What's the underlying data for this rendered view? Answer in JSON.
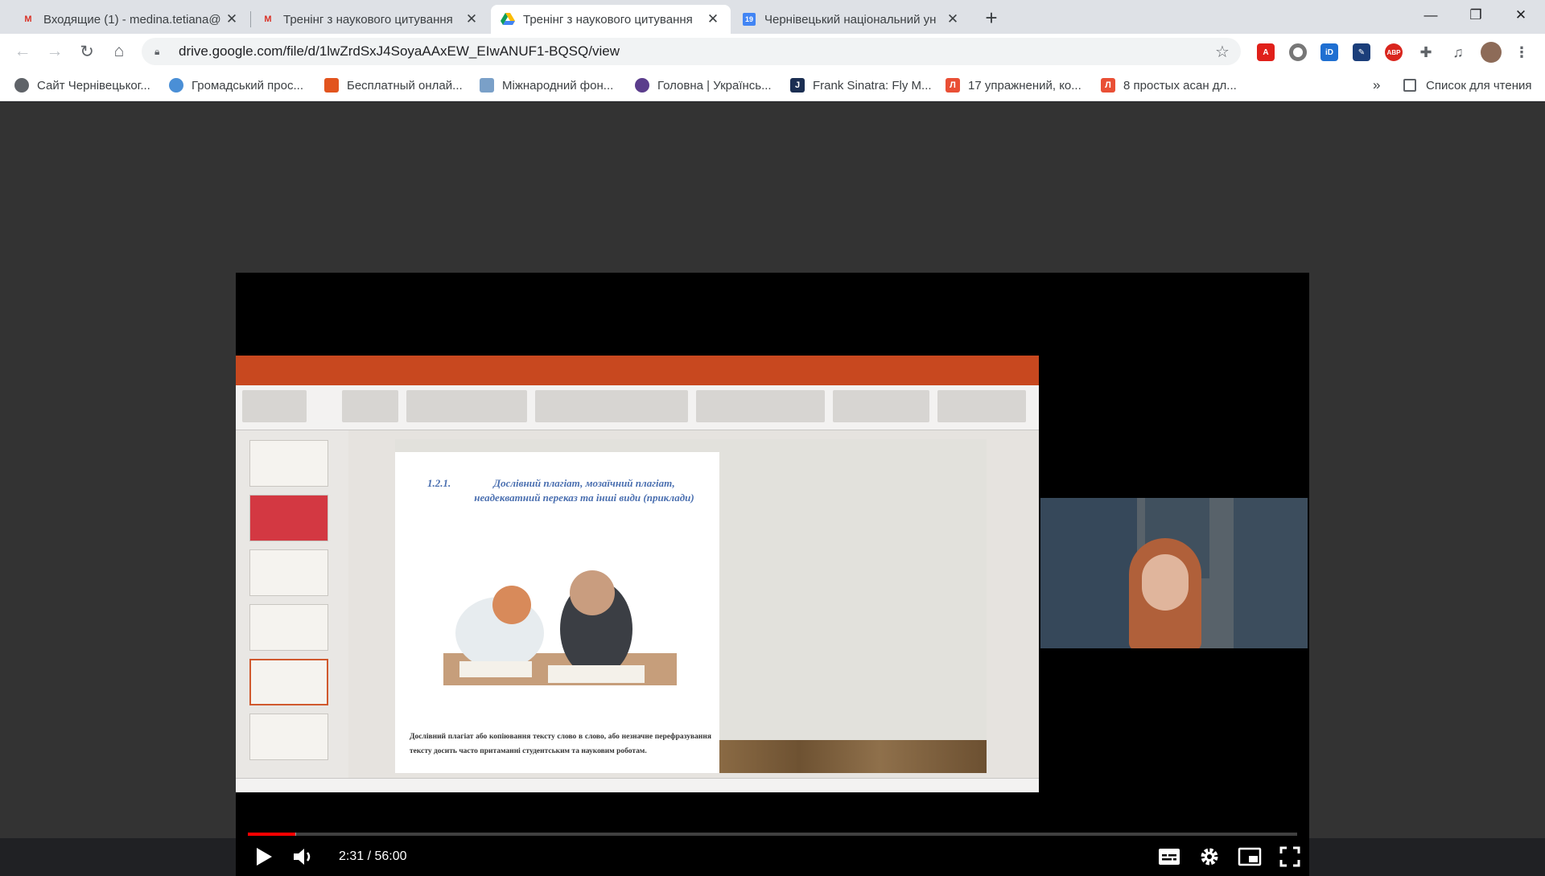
{
  "browser": {
    "tabs": [
      {
        "title": "Входящие (1) - medina.tetiana@",
        "icon": "gmail-icon",
        "active": false
      },
      {
        "title": "Тренінг з наукового цитування",
        "icon": "gmail-icon",
        "active": false
      },
      {
        "title": "Тренінг з наукового цитування",
        "icon": "google-drive-icon",
        "active": true
      },
      {
        "title": "Чернівецький національний ун",
        "icon": "calendar-icon",
        "active": false
      }
    ],
    "new_tab": "+",
    "window_controls": {
      "minimize": "—",
      "restore": "❐",
      "close": "✕"
    }
  },
  "toolbar": {
    "url": "drive.google.com/file/d/1lwZrdSxJ4SoyaAAxEW_EIwANUF1-BQSQ/view",
    "extensions": [
      "pdf-icon",
      "circle-icon",
      "id-icon",
      "dictionary-icon",
      "adblock-icon",
      "puzzle-icon",
      "media-icon",
      "profile-avatar"
    ],
    "adblock_label": "ABP",
    "id_label": "iD"
  },
  "bookmarks": {
    "items": [
      {
        "label": "Сайт Чернівецьког...",
        "color": "#5f6368"
      },
      {
        "label": "Громадський прос...",
        "color": "#4a8fd6"
      },
      {
        "label": "Бесплатный онлай...",
        "color": "#e2541e"
      },
      {
        "label": "Міжнародний фон...",
        "color": "#7aa0c8"
      },
      {
        "label": "Головна | Українсь...",
        "color": "#5b3d8c"
      },
      {
        "label": "Frank Sinatra: Fly M...",
        "color": "#1b2e52"
      },
      {
        "label": "17 упражнений, ко...",
        "color": "#e94f35"
      },
      {
        "label": "8 простых асан дл...",
        "color": "#e94f35"
      }
    ],
    "overflow": "»",
    "reading_list": "Список для чтения"
  },
  "slide": {
    "heading_num": "1.2.1.",
    "heading": "Дослівний плагіат, мозаїчний плагіат, неадекватний переказ та інші види (приклади)",
    "body": "Дослівний плагіат або копіювання тексту слово в слово, або незначне перефразування тексту досить часто притаманні студентським та науковим роботам."
  },
  "video": {
    "time": "2:31 / 56:00",
    "progress": 0.045,
    "buffered": 0.046,
    "colors": {
      "played": "#ff0000",
      "ppt_accent": "#c8481f"
    }
  }
}
